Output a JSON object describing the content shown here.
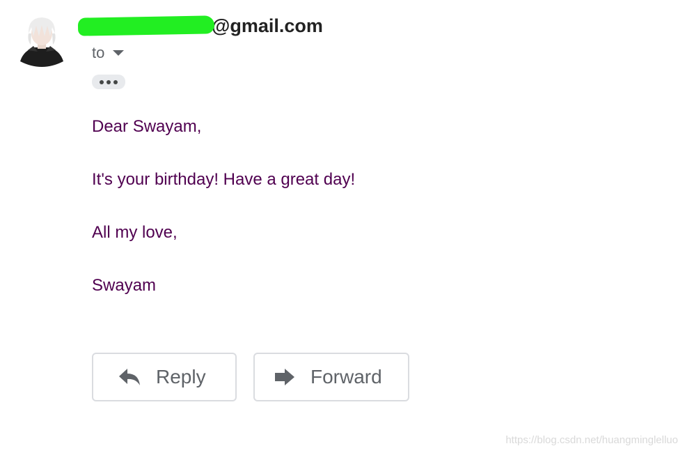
{
  "email": {
    "sender_suffix": "@gmail.com",
    "recipient_label": "to",
    "body_lines": [
      "Dear Swayam,",
      "It's your birthday! Have a great day!",
      "All my love,",
      "Swayam"
    ]
  },
  "actions": {
    "reply_label": "Reply",
    "forward_label": "Forward"
  },
  "icons": {
    "avatar": "avatar-image",
    "details": "chevron-down-icon",
    "trimmed_content": "more-horizontal-icon",
    "reply": "reply-arrow-icon",
    "forward": "forward-arrow-icon"
  },
  "watermark": "https://blog.csdn.net/huangminglelluo",
  "colors": {
    "body_text": "#500050",
    "redaction": "#22ee22",
    "button_border": "#dadce0"
  }
}
